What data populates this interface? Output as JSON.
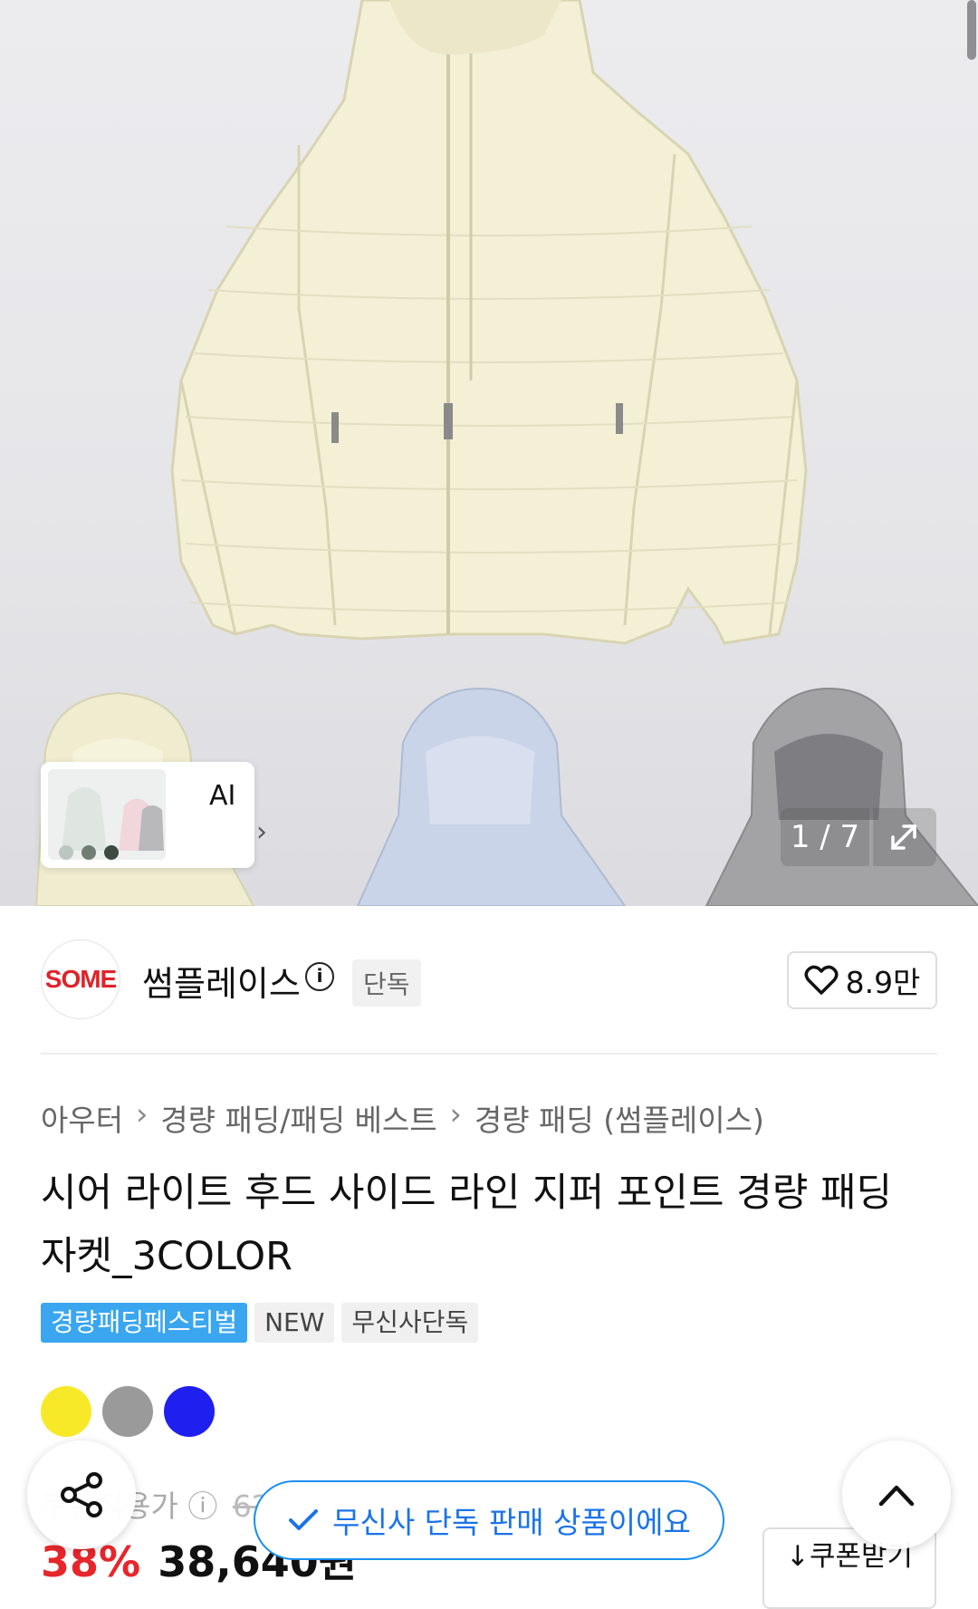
{
  "gallery": {
    "counter": "1 / 7",
    "ai_label": "AI"
  },
  "seller": {
    "logo_text": "SOME",
    "name": "썸플레이스",
    "badge": "단독",
    "likes": "8.9만"
  },
  "breadcrumb": [
    "아우터",
    "경량 패딩/패딩 베스트",
    "경량 패딩 (썸플레이스)"
  ],
  "product": {
    "title": "시어 라이트 후드 사이드 라인 지퍼 포인트 경량 패딩 자켓_3COLOR",
    "tags": [
      "경량패딩페스티벌",
      "NEW",
      "무신사단독"
    ],
    "colors": [
      "#f7e928",
      "#9a9a9a",
      "#1f1ff0"
    ]
  },
  "price": {
    "label": "쿠폰적용가",
    "original": "62",
    "discount": "38%",
    "amount": "38,640원"
  },
  "coupon": {
    "label": "↓쿠폰받기"
  },
  "toast": {
    "text": "무신사 단독 판매 상품이에요"
  }
}
